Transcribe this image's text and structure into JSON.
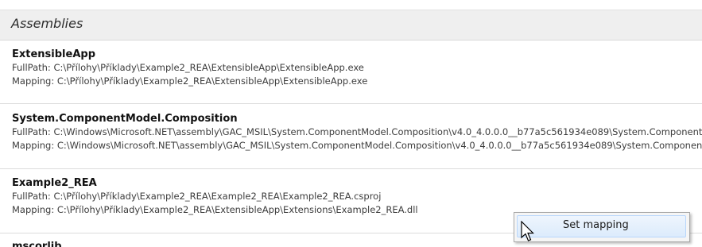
{
  "header": {
    "title": "Assemblies"
  },
  "assemblies": [
    {
      "name": "ExtensibleApp",
      "fullpath": "FullPath: C:\\Přílohy\\Příklady\\Example2_REA\\ExtensibleApp\\ExtensibleApp.exe",
      "mapping": "Mapping: C:\\Přílohy\\Příklady\\Example2_REA\\ExtensibleApp\\ExtensibleApp.exe"
    },
    {
      "name": "System.ComponentModel.Composition",
      "fullpath": "FullPath: C:\\Windows\\Microsoft.NET\\assembly\\GAC_MSIL\\System.ComponentModel.Composition\\v4.0_4.0.0.0__b77a5c561934e089\\System.ComponentModel.Composition.dll",
      "mapping": "Mapping: C:\\Windows\\Microsoft.NET\\assembly\\GAC_MSIL\\System.ComponentModel.Composition\\v4.0_4.0.0.0__b77a5c561934e089\\System.ComponentModel.Composition.dll"
    },
    {
      "name": "Example2_REA",
      "fullpath": "FullPath: C:\\Přílohy\\Příklady\\Example2_REA\\Example2_REA\\Example2_REA.csproj",
      "mapping": "Mapping: C:\\Přílohy\\Příklady\\Example2_REA\\ExtensibleApp\\Extensions\\Example2_REA.dll"
    },
    {
      "name": "mscorlib"
    }
  ],
  "context_menu": {
    "items": [
      {
        "label": "Set mapping"
      }
    ]
  }
}
